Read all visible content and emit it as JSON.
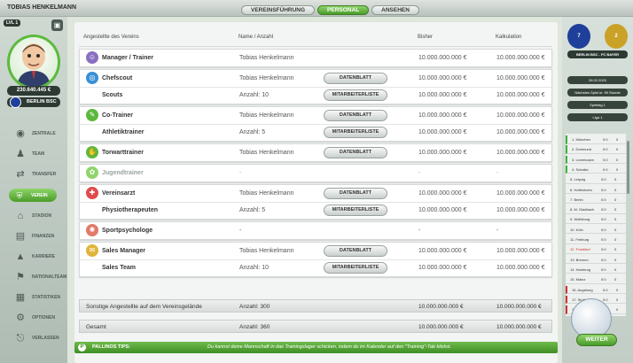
{
  "header": {
    "manager_name": "TOBIAS HENKELMANN",
    "tabs": [
      {
        "label": "VEREINSFÜHRUNG",
        "active": false
      },
      {
        "label": "PERSONAL",
        "active": true
      },
      {
        "label": "ANSEHEN",
        "active": false
      }
    ]
  },
  "sidebar": {
    "level": "LVL 1",
    "money": "230.640.445 €",
    "club": "BERLIN BSC",
    "items": [
      {
        "label": "ZENTRALE",
        "icon": "soccer-ball-icon"
      },
      {
        "label": "TEAM",
        "icon": "team-icon"
      },
      {
        "label": "TRANSFER",
        "icon": "transfer-icon"
      },
      {
        "label": "VEREIN",
        "icon": "club-icon",
        "active": true
      },
      {
        "label": "STADION",
        "icon": "stadium-icon"
      },
      {
        "label": "FINANZEN",
        "icon": "finance-icon"
      },
      {
        "label": "KARRIERE",
        "icon": "career-icon"
      },
      {
        "label": "NATIONALTEAM",
        "icon": "national-team-icon"
      },
      {
        "label": "STATISTIKEN",
        "icon": "statistics-icon"
      },
      {
        "label": "OPTIONEN",
        "icon": "options-gear-icon"
      },
      {
        "label": "VERLASSEN",
        "icon": "exit-icon"
      }
    ]
  },
  "table": {
    "headers": {
      "role": "Angestellte des Vereins",
      "name": "Name / Anzahl",
      "so_far": "Bisher",
      "calc": "Kalkulation"
    },
    "groups": [
      {
        "rows": [
          {
            "role": "Manager / Trainer",
            "name": "Tobias Henkelmann",
            "so_far": "10.000.000.000 €",
            "calc": "10.000.000.000 €",
            "icon": "manager-icon",
            "color": "#8a6fc2"
          }
        ]
      },
      {
        "rows": [
          {
            "role": "Chefscout",
            "name": "Tobias Henkelmann",
            "button": "DATENBLATT",
            "so_far": "10.000.000.000 €",
            "calc": "10.000.000.000 €",
            "icon": "scout-icon",
            "color": "#3a8fd6"
          },
          {
            "role": "Scouts",
            "name": "Anzahl: 10",
            "button": "MITARBEITERLISTE",
            "so_far": "10.000.000.000 €",
            "calc": "10.000.000.000 €"
          }
        ]
      },
      {
        "rows": [
          {
            "role": "Co-Trainer",
            "name": "Tobias Henkelmann",
            "button": "DATENBLATT",
            "so_far": "10.000.000.000 €",
            "calc": "10.000.000.000 €",
            "icon": "co-trainer-icon",
            "color": "#5cb83c"
          },
          {
            "role": "Athletiktrainer",
            "name": "Anzahl: 5",
            "button": "MITARBEITERLISTE",
            "so_far": "10.000.000.000 €",
            "calc": "10.000.000.000 €"
          }
        ]
      },
      {
        "rows": [
          {
            "role": "Torwarttrainer",
            "name": "Tobias Henkelmann",
            "button": "DATENBLATT",
            "so_far": "10.000.000.000 €",
            "calc": "10.000.000.000 €",
            "icon": "goalkeeper-icon",
            "color": "#5cb83c"
          }
        ]
      },
      {
        "rows": [
          {
            "role": "Jugendtrainer",
            "name": "-",
            "so_far": "-",
            "calc": "-",
            "icon": "youth-icon",
            "color": "#8fd46a",
            "dim": true
          }
        ]
      },
      {
        "rows": [
          {
            "role": "Vereinsarzt",
            "name": "Tobias Henkelmann",
            "button": "DATENBLATT",
            "so_far": "10.000.000.000 €",
            "calc": "10.000.000.000 €",
            "icon": "doctor-icon",
            "color": "#e04b4b"
          },
          {
            "role": "Physiotherapeuten",
            "name": "Anzahl: 5",
            "button": "MITARBEITERLISTE",
            "so_far": "10.000.000.000 €",
            "calc": "10.000.000.000 €"
          }
        ]
      },
      {
        "rows": [
          {
            "role": "Sportpsychologe",
            "name": "-",
            "so_far": "-",
            "calc": "-",
            "icon": "psychologist-icon",
            "color": "#e07a6a"
          }
        ]
      },
      {
        "rows": [
          {
            "role": "Sales Manager",
            "name": "Tobias Henkelmann",
            "button": "DATENBLATT",
            "so_far": "10.000.000.000 €",
            "calc": "10.000.000.000 €",
            "icon": "sales-icon",
            "color": "#e0b43a"
          },
          {
            "role": "Sales Team",
            "name": "Anzahl: 10",
            "button": "MITARBEITERLISTE",
            "so_far": "10.000.000.000 €",
            "calc": "10.000.000.000 €"
          }
        ]
      }
    ],
    "summary": [
      {
        "role": "Sonstige Angestellte auf dem Vereinsgelände",
        "name": "Anzahl: 300",
        "so_far": "10.000.000.000 €",
        "calc": "10.000.000.000 €"
      },
      {
        "role": "Gesamt",
        "name": "Anzahl: 360",
        "so_far": "10.000.000.000 €",
        "calc": "10.000.000.000 €"
      }
    ]
  },
  "tips": {
    "label": "PALLINOS TIPS:",
    "text": "Du kannst deine Mannschaft in das Trainingslager schicken, indem du im Kalender auf den \"Training\"-Tab klickst."
  },
  "right_panel": {
    "badge_left": "7",
    "badge_right": "2",
    "match": "BERLIN BSC - FC BAYER",
    "date": "26.02.2020",
    "next_match": "Nächstes Spiel in: 99 Stunde",
    "matchday": "Spieltag 1",
    "league": "Liga 1",
    "standings": [
      {
        "name": "1. München",
        "goals": "0:0",
        "pts": "0",
        "mark": "green"
      },
      {
        "name": "2. Dortmund",
        "goals": "0:0",
        "pts": "0",
        "mark": "green"
      },
      {
        "name": "3. Leverkusen",
        "goals": "0:0",
        "pts": "0",
        "mark": "green"
      },
      {
        "name": "4. Schalke",
        "goals": "0:0",
        "pts": "0",
        "mark": "green"
      },
      {
        "name": "5. Leipzig",
        "goals": "0:0",
        "pts": "0"
      },
      {
        "name": "6. Hoffenheim",
        "goals": "0:0",
        "pts": "0"
      },
      {
        "name": "7. Berlin",
        "goals": "0:0",
        "pts": "0"
      },
      {
        "name": "8. M. Gladbach",
        "goals": "0:0",
        "pts": "0"
      },
      {
        "name": "9. Wolfsburg",
        "goals": "0:0",
        "pts": "0"
      },
      {
        "name": "10. Köln",
        "goals": "0:0",
        "pts": "0"
      },
      {
        "name": "11. Freiburg",
        "goals": "0:0",
        "pts": "0"
      },
      {
        "name": "12. Frankfurt",
        "goals": "0:0",
        "pts": "0",
        "highlight": true
      },
      {
        "name": "13. Bremen",
        "goals": "0:0",
        "pts": "0"
      },
      {
        "name": "14. Hamburg",
        "goals": "0:0",
        "pts": "0"
      },
      {
        "name": "15. Mainz",
        "goals": "0:0",
        "pts": "0"
      },
      {
        "name": "16. Augsburg",
        "goals": "0:0",
        "pts": "0",
        "mark": "red"
      },
      {
        "name": "17. Stuttgart",
        "goals": "0:0",
        "pts": "0",
        "mark": "red"
      },
      {
        "name": "18. Hannover",
        "goals": "0:0",
        "pts": "0",
        "mark": "red"
      }
    ],
    "continue_button": "WEITER"
  }
}
